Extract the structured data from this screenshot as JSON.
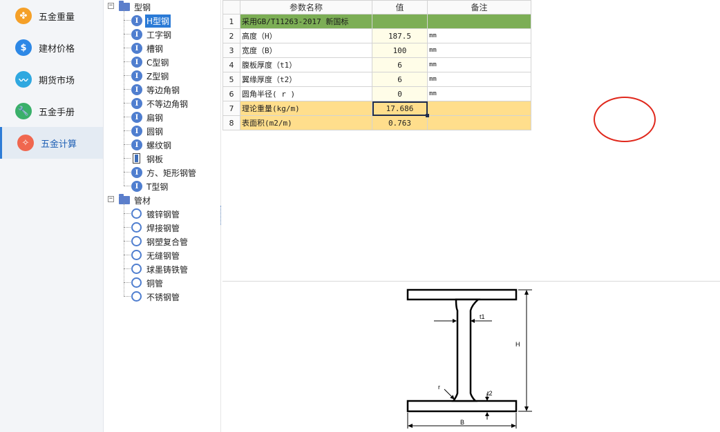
{
  "nav": {
    "items": [
      {
        "label": "五金重量",
        "icon": "clover-icon",
        "color": "#f5a028"
      },
      {
        "label": "建材价格",
        "icon": "dollar-icon",
        "color": "#2d88e6"
      },
      {
        "label": "期货市场",
        "icon": "trend-chart-icon",
        "color": "#2fa8e0"
      },
      {
        "label": "五金手册",
        "icon": "wrench-icon",
        "color": "#3ab06a"
      },
      {
        "label": "五金计算",
        "icon": "magic-wand-icon",
        "color": "#f0674f"
      }
    ],
    "active_index": 4
  },
  "tree": {
    "groups": [
      {
        "label": "型钢",
        "expanded": true,
        "children": [
          {
            "label": "H型钢",
            "icon": "i-beam-icon",
            "selected": true
          },
          {
            "label": "工字钢",
            "icon": "i-beam-icon"
          },
          {
            "label": "槽钢",
            "icon": "i-beam-icon"
          },
          {
            "label": "C型钢",
            "icon": "i-beam-icon"
          },
          {
            "label": "Z型钢",
            "icon": "i-beam-icon"
          },
          {
            "label": "等边角钢",
            "icon": "i-beam-icon"
          },
          {
            "label": "不等边角钢",
            "icon": "i-beam-icon"
          },
          {
            "label": "扁钢",
            "icon": "i-beam-icon"
          },
          {
            "label": "圆钢",
            "icon": "i-beam-icon"
          },
          {
            "label": "螺纹钢",
            "icon": "i-beam-icon"
          },
          {
            "label": "钢板",
            "icon": "plate-icon"
          },
          {
            "label": "方、矩形钢管",
            "icon": "i-beam-icon"
          },
          {
            "label": "T型钢",
            "icon": "i-beam-icon"
          }
        ]
      },
      {
        "label": "管材",
        "expanded": true,
        "children": [
          {
            "label": "镀锌钢管",
            "icon": "pipe-ring-icon"
          },
          {
            "label": "焊接钢管",
            "icon": "pipe-ring-icon"
          },
          {
            "label": "钢塑复合管",
            "icon": "pipe-ring-icon"
          },
          {
            "label": "无缝钢管",
            "icon": "pipe-ring-icon"
          },
          {
            "label": "球墨铸铁管",
            "icon": "pipe-ring-icon"
          },
          {
            "label": "铜管",
            "icon": "pipe-ring-icon"
          },
          {
            "label": "不锈钢管",
            "icon": "pipe-ring-icon"
          }
        ]
      }
    ],
    "collapse_symbol": "−"
  },
  "grid": {
    "headers": {
      "name": "参数名称",
      "value": "值",
      "note": "备注"
    },
    "rows": [
      {
        "num": "1",
        "name": "采用GB/T11263-2017 新国标",
        "value": "",
        "note": "",
        "style": "green"
      },
      {
        "num": "2",
        "name": "高度（H）",
        "value": "187.5",
        "note": "mm",
        "style": "input"
      },
      {
        "num": "3",
        "name": "宽度（B）",
        "value": "100",
        "note": "mm",
        "style": "input"
      },
      {
        "num": "4",
        "name": "腹板厚度（t1）",
        "value": "6",
        "note": "mm",
        "style": "input"
      },
      {
        "num": "5",
        "name": "翼缘厚度（t2）",
        "value": "6",
        "note": "mm",
        "style": "input"
      },
      {
        "num": "6",
        "name": "圆角半径( r )",
        "value": "0",
        "note": "mm",
        "style": "input"
      },
      {
        "num": "7",
        "name": "理论重量(kg/m)",
        "value": "17.686",
        "note": "",
        "style": "gold",
        "active": true
      },
      {
        "num": "8",
        "name": "表面积(m2/m)",
        "value": "0.763",
        "note": "",
        "style": "gold"
      }
    ]
  },
  "diagram": {
    "labels": {
      "t1": "t1",
      "t2": "t2",
      "H": "H",
      "B": "B",
      "r": "r"
    }
  },
  "colors": {
    "accent": "#2a7ad6",
    "header_green": "#7cae55",
    "result_gold": "#ffde8c",
    "annotation_red": "#e0281c"
  }
}
